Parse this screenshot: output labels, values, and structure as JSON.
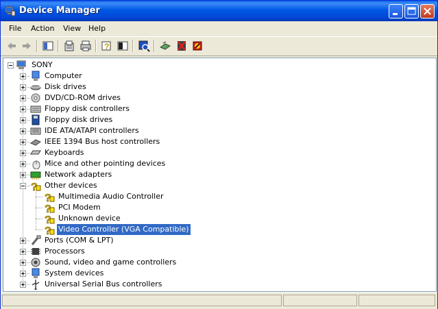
{
  "window": {
    "title": "Device Manager"
  },
  "menu": [
    "File",
    "Action",
    "View",
    "Help"
  ],
  "tree": {
    "root": "SONY",
    "categories": [
      {
        "label": "Computer",
        "icon": "computer-icon"
      },
      {
        "label": "Disk drives",
        "icon": "disk-drive-icon"
      },
      {
        "label": "DVD/CD-ROM drives",
        "icon": "cdrom-icon"
      },
      {
        "label": "Floppy disk controllers",
        "icon": "floppy-controller-icon"
      },
      {
        "label": "Floppy disk drives",
        "icon": "floppy-drive-icon"
      },
      {
        "label": "IDE ATA/ATAPI controllers",
        "icon": "ide-controller-icon"
      },
      {
        "label": "IEEE 1394 Bus host controllers",
        "icon": "ieee1394-icon"
      },
      {
        "label": "Keyboards",
        "icon": "keyboard-icon"
      },
      {
        "label": "Mice and other pointing devices",
        "icon": "mouse-icon"
      },
      {
        "label": "Network adapters",
        "icon": "network-adapter-icon"
      },
      {
        "label": "Other devices",
        "icon": "unknown-device-icon",
        "expanded": true
      },
      {
        "label": "Ports (COM & LPT)",
        "icon": "port-icon"
      },
      {
        "label": "Processors",
        "icon": "processor-icon"
      },
      {
        "label": "Sound, video and game controllers",
        "icon": "sound-icon"
      },
      {
        "label": "System devices",
        "icon": "system-device-icon"
      },
      {
        "label": "Universal Serial Bus controllers",
        "icon": "usb-icon"
      }
    ],
    "other_devices": [
      {
        "label": "Multimedia Audio Controller"
      },
      {
        "label": "PCI Modem"
      },
      {
        "label": "Unknown device"
      },
      {
        "label": "Video Controller (VGA Compatible)",
        "selected": true
      }
    ]
  }
}
